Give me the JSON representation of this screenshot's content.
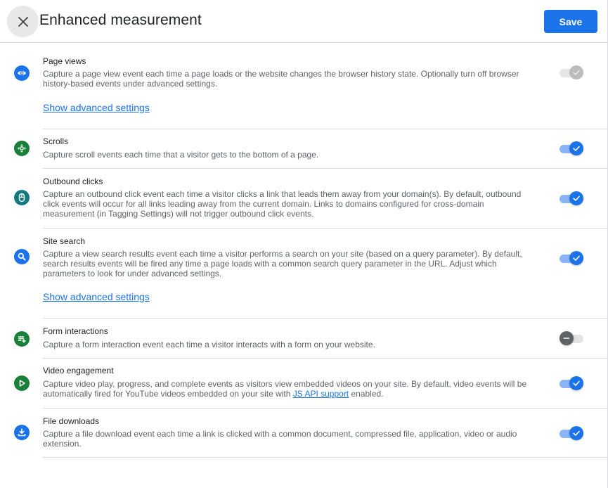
{
  "header": {
    "title": "Enhanced measurement",
    "close_icon": "close-icon",
    "save_label": "Save"
  },
  "colors": {
    "accent": "#1a73e8",
    "green": "#188038",
    "teal": "#12797f",
    "toggle_track_on": "#8ab4f8",
    "toggle_disabled": "#bdbdbd",
    "toggle_off_thumb": "#5f6368"
  },
  "settings": [
    {
      "title": "Page views",
      "icon": "eye-icon",
      "description": "Capture a page view event each time a page loads or the website changes the browser history state. Optionally turn off browser history-based events under advanced settings.",
      "advanced_link": "Show advanced settings",
      "state": "on-disabled"
    },
    {
      "title": "Scrolls",
      "icon": "scroll-icon",
      "description": "Capture scroll events each time that a visitor gets to the bottom of a page.",
      "state": "on"
    },
    {
      "title": "Outbound clicks",
      "icon": "mouse-icon",
      "description": "Capture an outbound click event each time a visitor clicks a link that leads them away from your domain(s). By default, outbound click events will occur for all links leading away from the current domain. Links to domains configured for cross-domain measurement (in Tagging Settings) will not trigger outbound click events.",
      "state": "on"
    },
    {
      "title": "Site search",
      "icon": "search-icon",
      "description": "Capture a view search results event each time a visitor performs a search on your site (based on a query parameter). By default, search results events will be fired any time a page loads with a common search query parameter in the URL. Adjust which parameters to look for under advanced settings.",
      "advanced_link": "Show advanced settings",
      "state": "on"
    },
    {
      "title": "Form interactions",
      "icon": "form-icon",
      "description": "Capture a form interaction event each time a visitor interacts with a form on your website.",
      "state": "off"
    },
    {
      "title": "Video engagement",
      "icon": "play-icon",
      "description_before": "Capture video play, progress, and complete events as visitors view embedded videos on your site. By default, video events will be automatically fired for YouTube videos embedded on your site with ",
      "description_link": "JS API support",
      "description_after": " enabled.",
      "state": "on"
    },
    {
      "title": "File downloads",
      "icon": "download-icon",
      "description": "Capture a file download event each time a link is clicked with a common document, compressed file, application, video or audio extension.",
      "state": "on"
    }
  ]
}
